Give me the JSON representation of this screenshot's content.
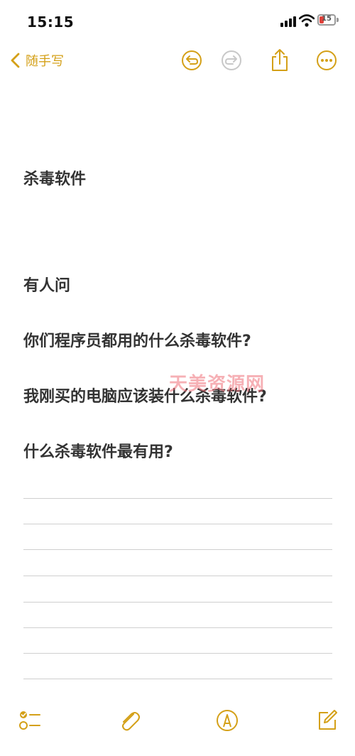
{
  "status_bar": {
    "time": "15:15",
    "battery_level": "15"
  },
  "nav": {
    "back_label": "随手写",
    "icons": [
      "chevron-left-icon",
      "undo-icon",
      "redo-icon",
      "share-icon",
      "more-icon"
    ]
  },
  "note": {
    "title": "杀毒软件",
    "lines": [
      "有人问",
      "你们程序员都用的什么杀毒软件?",
      "我刚买的电脑应该装什么杀毒软件?",
      "什么杀毒软件最有用?"
    ]
  },
  "watermark": "天美资源网",
  "toolbar": {
    "icons": [
      "checklist-icon",
      "paperclip-icon",
      "markup-pen-icon",
      "compose-icon"
    ]
  },
  "colors": {
    "accent": "#d4a018",
    "text": "#333333",
    "rule": "#cfcfcf",
    "battery_low": "#e0413a"
  }
}
